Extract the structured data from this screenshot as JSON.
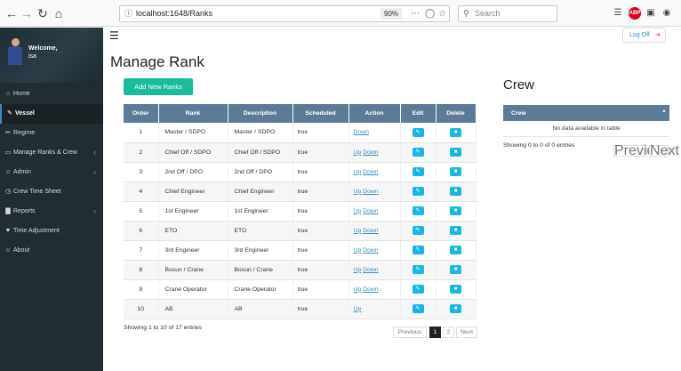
{
  "browser": {
    "url": "localhost:1648/Ranks",
    "zoom": "90%",
    "search_placeholder": "Search",
    "stop_badge": "ABP"
  },
  "sidebar": {
    "welcome": "Welcome,",
    "username": "isa",
    "items": [
      {
        "label": "Home",
        "icon": "home-icon",
        "active": false,
        "has_children": false
      },
      {
        "label": "Vessel",
        "icon": "edit-icon",
        "active": true,
        "has_children": false
      },
      {
        "label": "Regime",
        "icon": "regime-icon",
        "active": false,
        "has_children": false
      },
      {
        "label": "Manage Ranks & Crew",
        "icon": "monitor-icon",
        "active": false,
        "has_children": true
      },
      {
        "label": "Admin",
        "icon": "user-icon",
        "active": false,
        "has_children": true
      },
      {
        "label": "Crew Time Sheet",
        "icon": "clock-icon",
        "active": false,
        "has_children": false
      },
      {
        "label": "Reports",
        "icon": "bar-chart-icon",
        "active": false,
        "has_children": true
      },
      {
        "label": "Time Adjustment",
        "icon": "filter-icon",
        "active": false,
        "has_children": false
      },
      {
        "label": "About",
        "icon": "user-icon",
        "active": false,
        "has_children": false
      }
    ]
  },
  "header": {
    "logoff_label": "Log Off"
  },
  "main": {
    "title": "Manage Rank",
    "add_button": "Add New Ranks",
    "columns": [
      "Order",
      "Rank",
      "Description",
      "Scheduled",
      "Action",
      "Edit",
      "Delete"
    ],
    "up_label": "Up",
    "down_label": "Down",
    "rows": [
      {
        "order": "1",
        "rank": "Master / SDPO",
        "description": "Master / SDPO",
        "scheduled": "true",
        "up": false,
        "down": true
      },
      {
        "order": "2",
        "rank": "Chief Off / SDPO",
        "description": "Chief Off / SDPO",
        "scheduled": "true",
        "up": true,
        "down": true
      },
      {
        "order": "3",
        "rank": "2nd Off / DPO",
        "description": "2nd Off / DPO",
        "scheduled": "true",
        "up": true,
        "down": true
      },
      {
        "order": "4",
        "rank": "Chief Engineer",
        "description": "Chief Engineer",
        "scheduled": "true",
        "up": true,
        "down": true
      },
      {
        "order": "5",
        "rank": "1st Engineer",
        "description": "1st Engineer",
        "scheduled": "true",
        "up": true,
        "down": true
      },
      {
        "order": "6",
        "rank": "ETO",
        "description": "ETO",
        "scheduled": "true",
        "up": true,
        "down": true
      },
      {
        "order": "7",
        "rank": "3rd Engineer",
        "description": "3rd Engineer",
        "scheduled": "true",
        "up": true,
        "down": true
      },
      {
        "order": "8",
        "rank": "Bosun / Crane",
        "description": "Bosun / Crane",
        "scheduled": "true",
        "up": true,
        "down": true
      },
      {
        "order": "9",
        "rank": "Crane Operator",
        "description": "Crane Operator",
        "scheduled": "true",
        "up": true,
        "down": true
      },
      {
        "order": "10",
        "rank": "AB",
        "description": "AB",
        "scheduled": "true",
        "up": true,
        "down": false
      }
    ],
    "info": "Showing 1 to 10 of 17 entries",
    "pager": {
      "previous": "Previous",
      "pages": [
        "1",
        "2"
      ],
      "current": "1",
      "next": "Next"
    }
  },
  "crew": {
    "title": "Crew",
    "column": "Crew",
    "empty": "No data available in table",
    "info": "Showing 0 to 0 of 0 entries",
    "pager": {
      "previous": "Previous",
      "next": "Next"
    }
  },
  "colors": {
    "sidebar_bg": "#222d32",
    "table_header": "#5d7b96",
    "add_button": "#1abc9c",
    "icon_button": "#17b8e6",
    "link": "#3c8dbc"
  }
}
